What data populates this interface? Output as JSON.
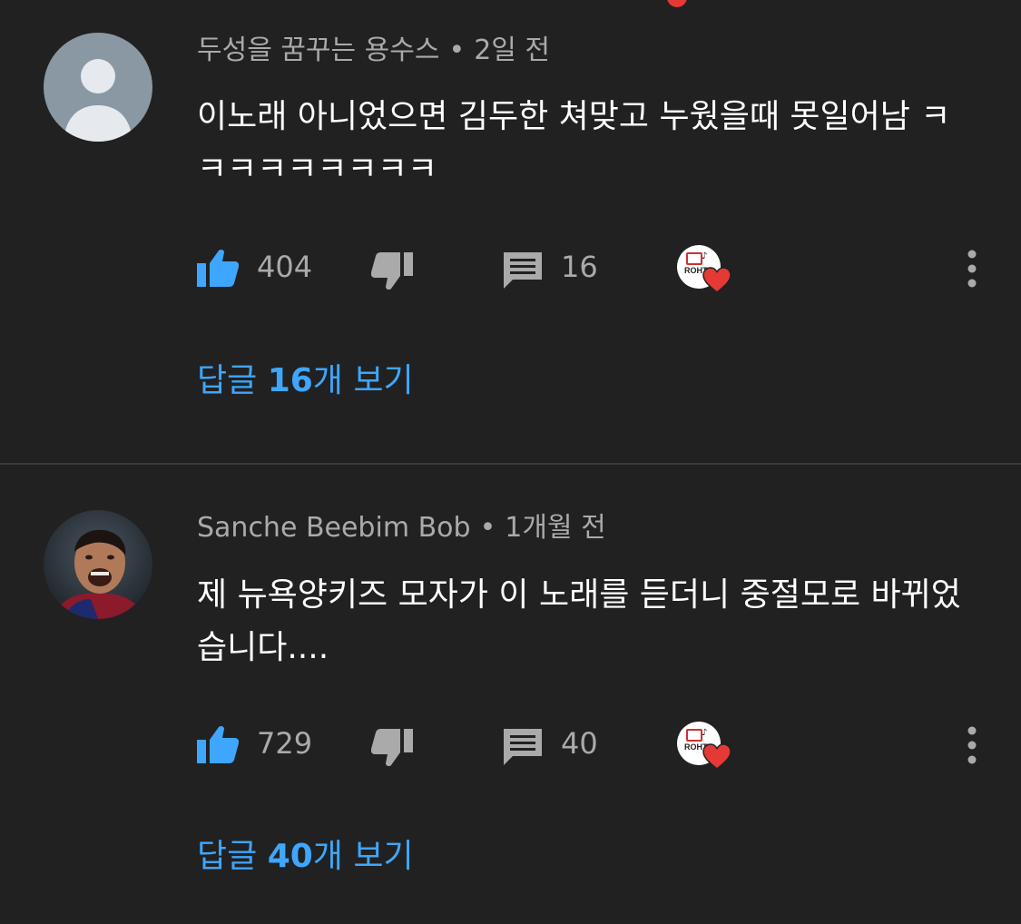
{
  "colors": {
    "background": "#212121",
    "meta_text": "#aaaaaa",
    "body_text": "#ffffff",
    "link_blue": "#3ea6ff",
    "like_blue": "#3ea6ff",
    "heart_red": "#e53935",
    "divider": "#3a3a3a"
  },
  "comments": [
    {
      "author": "두성을 꿈꾸는 용수스",
      "separator": "•",
      "time": "2일 전",
      "text": "이노래 아니었으면 김두한 쳐맞고 누웠을때 못일어남 ㅋㅋㅋㅋㅋㅋㅋㅋㅋ",
      "likes": "404",
      "replies": "16",
      "view_replies_prefix": "답글 ",
      "view_replies_count": "16",
      "view_replies_suffix": "개 보기",
      "creator_logo_text": "ROHTE",
      "avatar_type": "default-avatar-icon",
      "icons": [
        "thumbs-up-icon",
        "thumbs-down-icon",
        "comment-icon",
        "creator-heart-icon",
        "more-vertical-icon"
      ]
    },
    {
      "author": "Sanche Beebim Bob",
      "separator": "•",
      "time": "1개월 전",
      "text": "제 뉴욕양키즈 모자가 이 노래를 듣더니 중절모로 바뀌었습니다....",
      "likes": "729",
      "replies": "40",
      "view_replies_prefix": "답글 ",
      "view_replies_count": "40",
      "view_replies_suffix": "개 보기",
      "creator_logo_text": "ROHTE",
      "avatar_type": "user-photo-avatar",
      "icons": [
        "thumbs-up-icon",
        "thumbs-down-icon",
        "comment-icon",
        "creator-heart-icon",
        "more-vertical-icon"
      ]
    }
  ]
}
